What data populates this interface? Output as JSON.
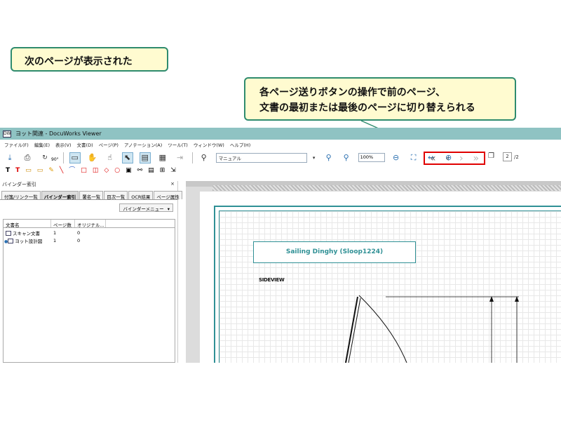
{
  "callouts": {
    "top": "次のページが表示された",
    "nav_line1": "各ページ送りボタンの操作で前のページ、",
    "nav_line2": "文書の最初または最後のページに切り替えられる"
  },
  "window": {
    "title": "ヨット関連 - DocuWorks Viewer"
  },
  "menu": [
    "ファイル(F)",
    "編集(E)",
    "表示(V)",
    "文書(D)",
    "ページ(P)",
    "アノテーション(A)",
    "ツール(T)",
    "ウィンドウ(W)",
    "ヘルプ(H)"
  ],
  "toolbar": {
    "rotate_label": "90°",
    "search_value": "マニュアル",
    "zoom_value": "100%",
    "current_page": "2",
    "total_pages": "/2"
  },
  "panel": {
    "title": "バインダー索引",
    "tabs": [
      "付箋/リンク一覧",
      "バインダー索引",
      "署名一覧",
      "目次一覧",
      "OCR結果",
      "ページ属性"
    ],
    "active_tab": 1,
    "menu_button": "バインダーメニュー",
    "columns": [
      "文書名",
      "ページ数",
      "オリジナル..."
    ],
    "rows": [
      {
        "name": "スキャン文書",
        "pages": "1",
        "original": "0",
        "current": false
      },
      {
        "name": "ヨット設計図",
        "pages": "1",
        "original": "0",
        "current": true
      }
    ]
  },
  "document": {
    "title_box": "Sailing Dinghy (Sloop1224)",
    "side_label": "SIDEVIEW"
  },
  "colors": {
    "callout_bg": "#fffbd0",
    "callout_border": "#2e8b6e",
    "titlebar": "#8fc3c3",
    "highlight_box": "#e00000",
    "drawing_teal": "#2f9095"
  }
}
